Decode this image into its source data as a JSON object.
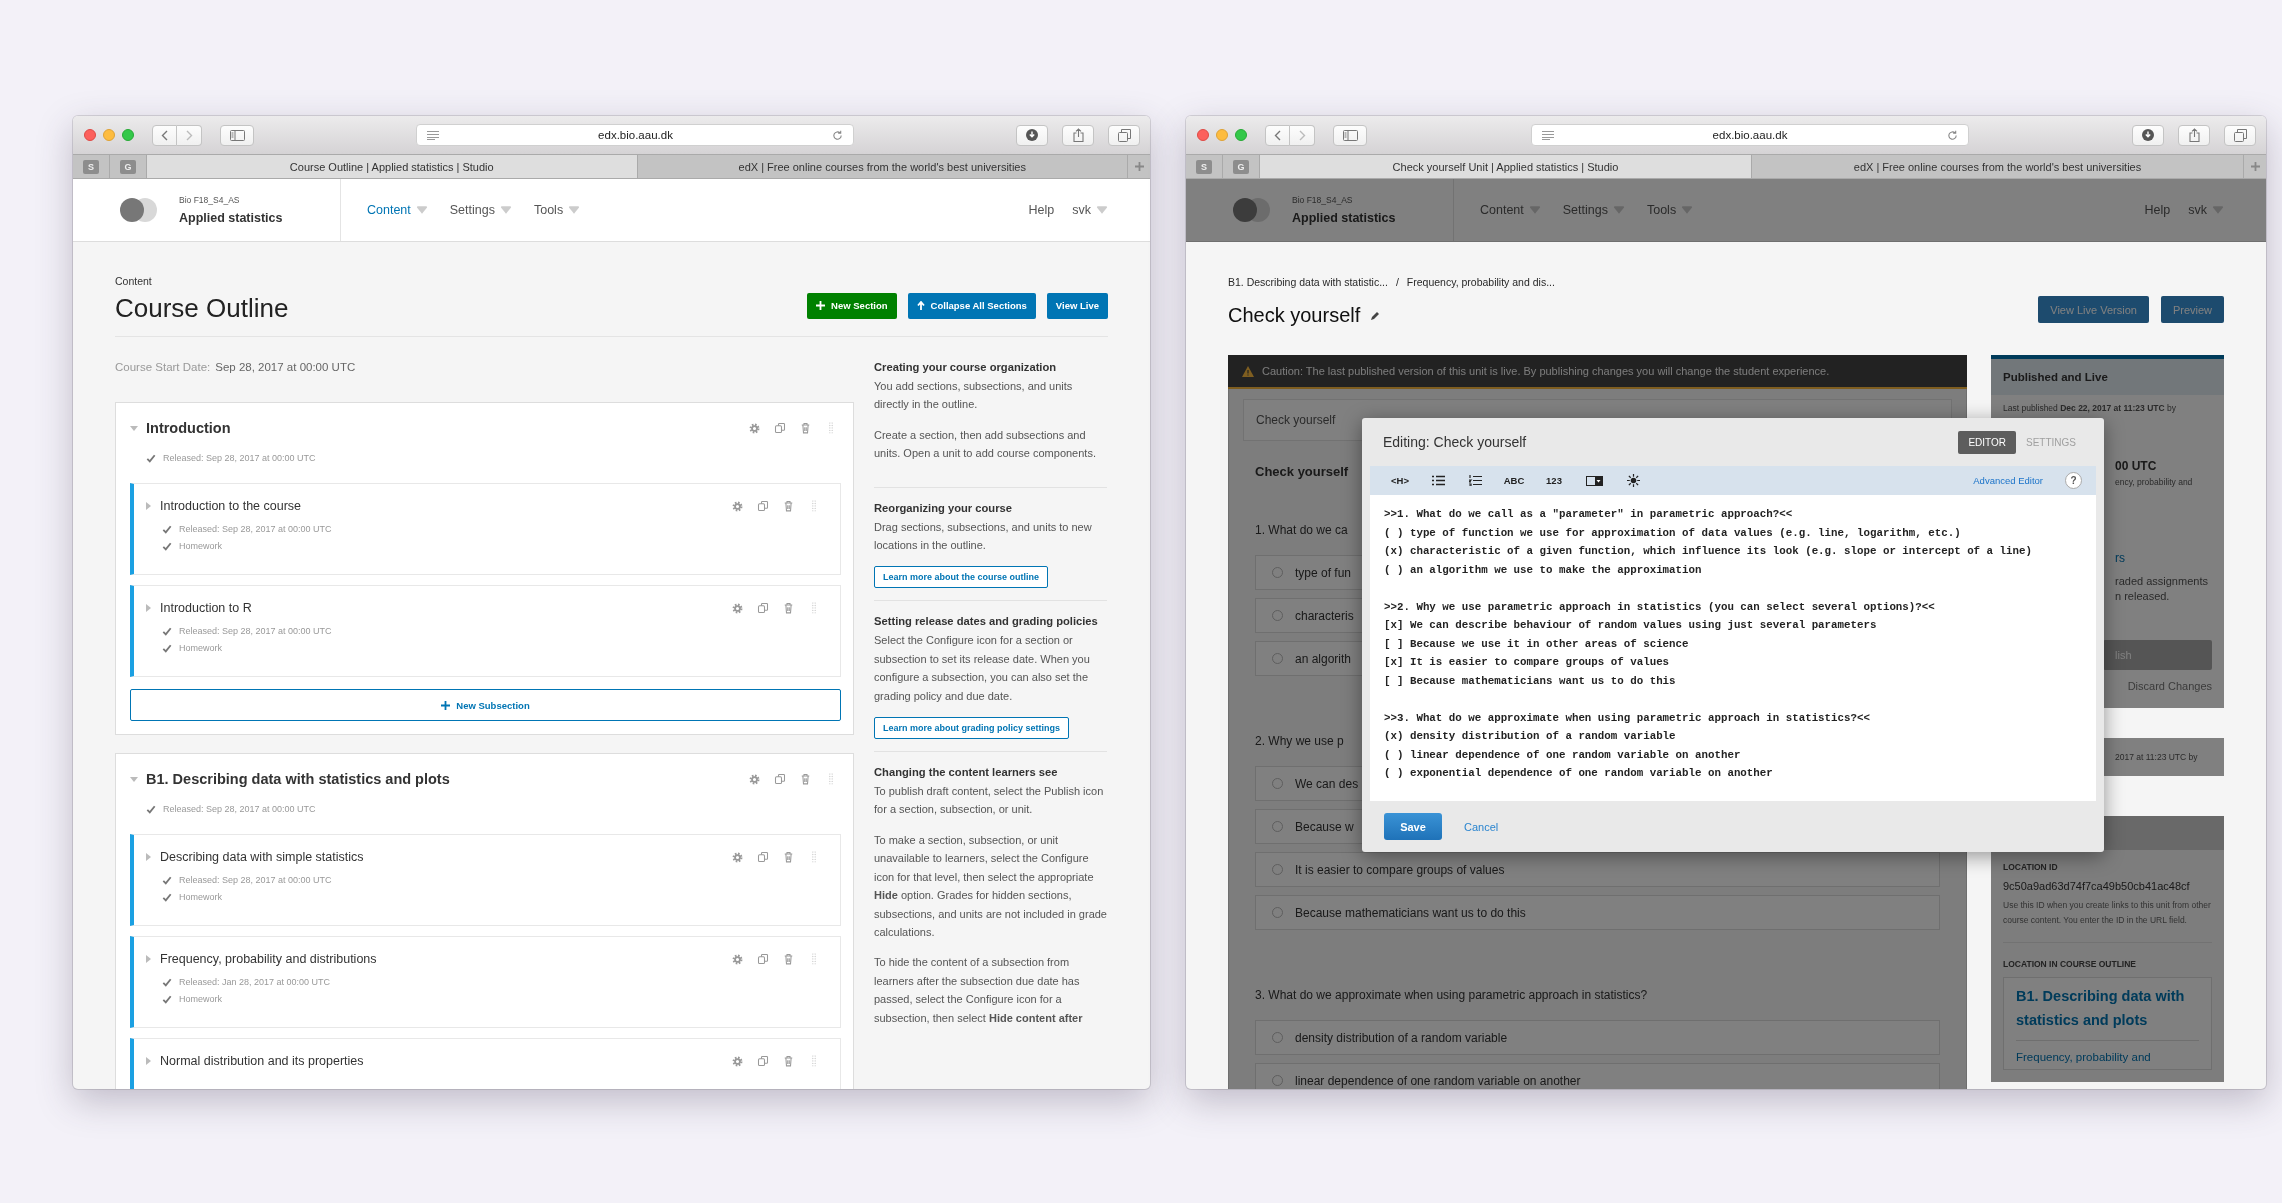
{
  "outline_window": {
    "browser": {
      "url": "edx.bio.aau.dk",
      "pinned_tabs": [
        "S",
        "G"
      ],
      "tabs": [
        {
          "label": "Course Outline | Applied statistics | Studio",
          "selected": true
        },
        {
          "label": "edX | Free online courses from the world's best universities",
          "selected": false
        }
      ]
    },
    "header": {
      "org": "Bio F18_S4_AS",
      "course": "Applied statistics",
      "nav": [
        {
          "label": "Content",
          "selected": true
        },
        {
          "label": "Settings",
          "selected": false
        },
        {
          "label": "Tools",
          "selected": false
        }
      ],
      "help": "Help",
      "user": "svk"
    },
    "eyebrow": "Content",
    "title": "Course Outline",
    "actions": [
      {
        "label": "New Section",
        "kind": "add"
      },
      {
        "label": "Collapse All Sections",
        "kind": "collapse"
      },
      {
        "label": "View Live",
        "kind": "plain"
      }
    ],
    "start_date": {
      "label": "Course Start Date:",
      "value": "Sep 28, 2017 at 00:00 UTC"
    },
    "sections": [
      {
        "title": "Introduction",
        "expanded": true,
        "released": "Released: Sep 28, 2017 at 00:00 UTC",
        "subsections": [
          {
            "title": "Introduction to the course",
            "expanded": false,
            "released": "Released: Sep 28, 2017 at 00:00 UTC",
            "grading": "Homework"
          },
          {
            "title": "Introduction to R",
            "expanded": false,
            "released": "Released: Sep 28, 2017 at 00:00 UTC",
            "grading": "Homework"
          }
        ],
        "new_subsection": "New Subsection"
      },
      {
        "title": "B1. Describing data with statistics and plots",
        "expanded": true,
        "released": "Released: Sep 28, 2017 at 00:00 UTC",
        "subsections": [
          {
            "title": "Describing data with simple statistics",
            "expanded": false,
            "released": "Released: Sep 28, 2017 at 00:00 UTC",
            "grading": "Homework"
          },
          {
            "title": "Frequency, probability and distributions",
            "expanded": false,
            "released": "Released: Jan 28, 2017 at 00:00 UTC",
            "grading": "Homework"
          },
          {
            "title": "Normal distribution and its properties",
            "expanded": false
          }
        ]
      }
    ],
    "help": [
      {
        "heading": "Creating your course organization",
        "paragraphs": [
          "You add sections, subsections, and units directly in the outline.",
          "Create a section, then add subsections and units. Open a unit to add course components."
        ]
      },
      {
        "heading": "Reorganizing your course",
        "paragraphs": [
          "Drag sections, subsections, and units to new locations in the outline."
        ],
        "link": "Learn more about the course outline"
      },
      {
        "heading": "Setting release dates and grading policies",
        "paragraphs": [
          "Select the Configure icon for a section or subsection to set its release date. When you configure a subsection, you can also set the grading policy and due date."
        ],
        "link": "Learn more about grading policy settings"
      },
      {
        "heading": "Changing the content learners see",
        "paragraphs": [
          "To publish draft content, select the Publish icon for a section, subsection, or unit.",
          "To make a section, subsection, or unit unavailable to learners, select the Configure icon for that level, then select the appropriate **Hide** option. Grades for hidden sections, subsections, and units are not included in grade calculations.",
          "To hide the content of a subsection from learners after the subsection due date has passed, select the Configure icon for a subsection, then select **Hide content after**"
        ]
      }
    ]
  },
  "unit_window": {
    "browser": {
      "url": "edx.bio.aau.dk",
      "pinned_tabs": [
        "S",
        "G"
      ],
      "tabs": [
        {
          "label": "Check yourself Unit | Applied statistics | Studio",
          "selected": true
        },
        {
          "label": "edX | Free online courses from the world's best universities",
          "selected": false
        }
      ]
    },
    "header": {
      "org": "Bio F18_S4_AS",
      "course": "Applied statistics",
      "nav": [
        {
          "label": "Content",
          "selected": false
        },
        {
          "label": "Settings",
          "selected": false
        },
        {
          "label": "Tools",
          "selected": false
        }
      ],
      "help": "Help",
      "user": "svk"
    },
    "breadcrumbs": [
      "B1. Describing data with statistic...",
      "Frequency, probability and dis..."
    ],
    "breadcrumb_separator": "/",
    "title": "Check yourself",
    "actions": [
      "View Live Version",
      "Preview"
    ],
    "caution": "Caution: The last published version of this unit is live. By publishing changes you will change the student experience.",
    "unit": {
      "label": "Check yourself",
      "heading": "Check yourself",
      "questions": [
        {
          "prompt": "1. What do we ca",
          "options": [
            {
              "text": "type of fun",
              "selected": false
            },
            {
              "text": "characteris",
              "selected": false
            },
            {
              "text": "an algorith",
              "selected": false
            }
          ]
        },
        {
          "prompt": "2. Why we use p",
          "options": [
            {
              "text": "We can des",
              "selected": false
            },
            {
              "text": "Because w",
              "selected": false
            },
            {
              "text": "It is easier to compare groups of values",
              "selected": false
            },
            {
              "text": "Because mathematicians want us to do this",
              "selected": false
            }
          ]
        },
        {
          "prompt": "3. What do we approximate when using parametric approach in statistics?",
          "options": [
            {
              "text": "density distribution of a random variable",
              "selected": false
            },
            {
              "text": "linear dependence of one random variable on another",
              "selected": false
            }
          ]
        }
      ]
    },
    "sidebar": {
      "status_title": "Published and Live",
      "last_published": "Last published **Dec 22, 2017 at 11:23 UTC** by",
      "fragments": [
        {
          "kind": "date",
          "text": "00 UTC"
        },
        {
          "kind": "note",
          "text": "ency, probability and"
        },
        {
          "kind": "link",
          "text": "rs"
        },
        {
          "kind": "text",
          "text": "raded assignments"
        },
        {
          "kind": "text",
          "text": "n released."
        },
        {
          "kind": "button",
          "text": "lish"
        },
        {
          "kind": "action",
          "text": "Discard Changes"
        }
      ],
      "edited": "2017 at 11:23 UTC by",
      "location_id_label": "LOCATION ID",
      "location_id": "9c50a9ad63d74f7ca49b50cb41ac48cf",
      "location_id_help": "Use this ID when you create links to this unit from other course content. You enter the ID in the URL field.",
      "outline_label": "LOCATION IN COURSE OUTLINE",
      "outline_section": "B1. Describing data with statistics and plots",
      "outline_subsection": "Frequency, probability and"
    },
    "modal": {
      "title": "Editing: Check yourself",
      "tabs": [
        {
          "label": "EDITOR",
          "selected": true
        },
        {
          "label": "SETTINGS",
          "selected": false
        }
      ],
      "toolbar": [
        {
          "kind": "text",
          "label": "<H>"
        },
        {
          "kind": "bullets"
        },
        {
          "kind": "numbers"
        },
        {
          "kind": "text",
          "label": "ABC"
        },
        {
          "kind": "text",
          "label": "123"
        },
        {
          "kind": "dropdown"
        },
        {
          "kind": "hint"
        }
      ],
      "advanced": "Advanced Editor",
      "help": "?",
      "blocks": [
        [
          ">>1. What do we call as a \"parameter\" in parametric approach?<<",
          "( ) type of function we use for approximation of data values (e.g. line, logarithm, etc.)",
          "(x) characteristic of a given function, which influence its look (e.g. slope or intercept of a line)",
          "( ) an algorithm we use to make the approximation"
        ],
        [
          ">>2. Why we use parametric approach in statistics (you can select several options)?<<",
          "[x] We can describe behaviour of random values using just several parameters",
          "[ ] Because we use it in other areas of science",
          "[x] It is easier to compare groups of values",
          "[ ] Because mathematicians want us to do this"
        ],
        [
          ">>3. What do we approximate when using parametric approach in statistics?<<",
          "(x) density distribution of a random variable",
          "( ) linear dependence of one random variable on another",
          "( ) exponential dependence of one random variable on another"
        ]
      ],
      "save": "Save",
      "cancel": "Cancel"
    }
  }
}
